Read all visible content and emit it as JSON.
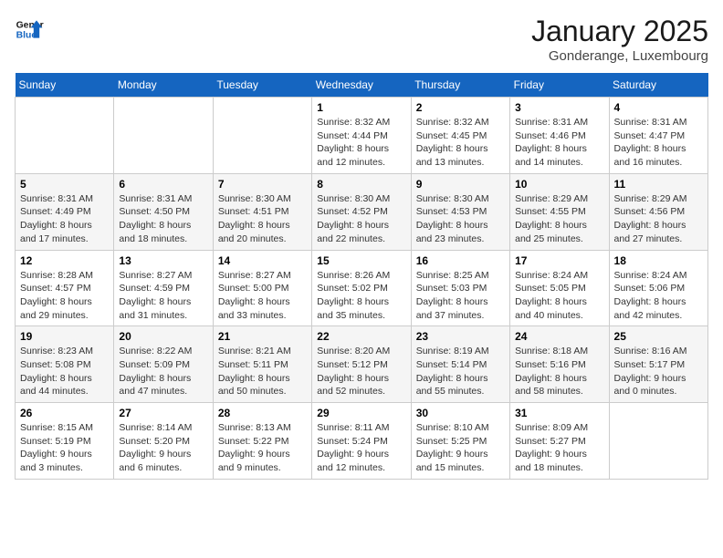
{
  "header": {
    "logo_line1": "General",
    "logo_line2": "Blue",
    "title": "January 2025",
    "subtitle": "Gonderange, Luxembourg"
  },
  "weekdays": [
    "Sunday",
    "Monday",
    "Tuesday",
    "Wednesday",
    "Thursday",
    "Friday",
    "Saturday"
  ],
  "weeks": [
    [
      {
        "day": "",
        "info": ""
      },
      {
        "day": "",
        "info": ""
      },
      {
        "day": "",
        "info": ""
      },
      {
        "day": "1",
        "info": "Sunrise: 8:32 AM\nSunset: 4:44 PM\nDaylight: 8 hours\nand 12 minutes."
      },
      {
        "day": "2",
        "info": "Sunrise: 8:32 AM\nSunset: 4:45 PM\nDaylight: 8 hours\nand 13 minutes."
      },
      {
        "day": "3",
        "info": "Sunrise: 8:31 AM\nSunset: 4:46 PM\nDaylight: 8 hours\nand 14 minutes."
      },
      {
        "day": "4",
        "info": "Sunrise: 8:31 AM\nSunset: 4:47 PM\nDaylight: 8 hours\nand 16 minutes."
      }
    ],
    [
      {
        "day": "5",
        "info": "Sunrise: 8:31 AM\nSunset: 4:49 PM\nDaylight: 8 hours\nand 17 minutes."
      },
      {
        "day": "6",
        "info": "Sunrise: 8:31 AM\nSunset: 4:50 PM\nDaylight: 8 hours\nand 18 minutes."
      },
      {
        "day": "7",
        "info": "Sunrise: 8:30 AM\nSunset: 4:51 PM\nDaylight: 8 hours\nand 20 minutes."
      },
      {
        "day": "8",
        "info": "Sunrise: 8:30 AM\nSunset: 4:52 PM\nDaylight: 8 hours\nand 22 minutes."
      },
      {
        "day": "9",
        "info": "Sunrise: 8:30 AM\nSunset: 4:53 PM\nDaylight: 8 hours\nand 23 minutes."
      },
      {
        "day": "10",
        "info": "Sunrise: 8:29 AM\nSunset: 4:55 PM\nDaylight: 8 hours\nand 25 minutes."
      },
      {
        "day": "11",
        "info": "Sunrise: 8:29 AM\nSunset: 4:56 PM\nDaylight: 8 hours\nand 27 minutes."
      }
    ],
    [
      {
        "day": "12",
        "info": "Sunrise: 8:28 AM\nSunset: 4:57 PM\nDaylight: 8 hours\nand 29 minutes."
      },
      {
        "day": "13",
        "info": "Sunrise: 8:27 AM\nSunset: 4:59 PM\nDaylight: 8 hours\nand 31 minutes."
      },
      {
        "day": "14",
        "info": "Sunrise: 8:27 AM\nSunset: 5:00 PM\nDaylight: 8 hours\nand 33 minutes."
      },
      {
        "day": "15",
        "info": "Sunrise: 8:26 AM\nSunset: 5:02 PM\nDaylight: 8 hours\nand 35 minutes."
      },
      {
        "day": "16",
        "info": "Sunrise: 8:25 AM\nSunset: 5:03 PM\nDaylight: 8 hours\nand 37 minutes."
      },
      {
        "day": "17",
        "info": "Sunrise: 8:24 AM\nSunset: 5:05 PM\nDaylight: 8 hours\nand 40 minutes."
      },
      {
        "day": "18",
        "info": "Sunrise: 8:24 AM\nSunset: 5:06 PM\nDaylight: 8 hours\nand 42 minutes."
      }
    ],
    [
      {
        "day": "19",
        "info": "Sunrise: 8:23 AM\nSunset: 5:08 PM\nDaylight: 8 hours\nand 44 minutes."
      },
      {
        "day": "20",
        "info": "Sunrise: 8:22 AM\nSunset: 5:09 PM\nDaylight: 8 hours\nand 47 minutes."
      },
      {
        "day": "21",
        "info": "Sunrise: 8:21 AM\nSunset: 5:11 PM\nDaylight: 8 hours\nand 50 minutes."
      },
      {
        "day": "22",
        "info": "Sunrise: 8:20 AM\nSunset: 5:12 PM\nDaylight: 8 hours\nand 52 minutes."
      },
      {
        "day": "23",
        "info": "Sunrise: 8:19 AM\nSunset: 5:14 PM\nDaylight: 8 hours\nand 55 minutes."
      },
      {
        "day": "24",
        "info": "Sunrise: 8:18 AM\nSunset: 5:16 PM\nDaylight: 8 hours\nand 58 minutes."
      },
      {
        "day": "25",
        "info": "Sunrise: 8:16 AM\nSunset: 5:17 PM\nDaylight: 9 hours\nand 0 minutes."
      }
    ],
    [
      {
        "day": "26",
        "info": "Sunrise: 8:15 AM\nSunset: 5:19 PM\nDaylight: 9 hours\nand 3 minutes."
      },
      {
        "day": "27",
        "info": "Sunrise: 8:14 AM\nSunset: 5:20 PM\nDaylight: 9 hours\nand 6 minutes."
      },
      {
        "day": "28",
        "info": "Sunrise: 8:13 AM\nSunset: 5:22 PM\nDaylight: 9 hours\nand 9 minutes."
      },
      {
        "day": "29",
        "info": "Sunrise: 8:11 AM\nSunset: 5:24 PM\nDaylight: 9 hours\nand 12 minutes."
      },
      {
        "day": "30",
        "info": "Sunrise: 8:10 AM\nSunset: 5:25 PM\nDaylight: 9 hours\nand 15 minutes."
      },
      {
        "day": "31",
        "info": "Sunrise: 8:09 AM\nSunset: 5:27 PM\nDaylight: 9 hours\nand 18 minutes."
      },
      {
        "day": "",
        "info": ""
      }
    ]
  ]
}
